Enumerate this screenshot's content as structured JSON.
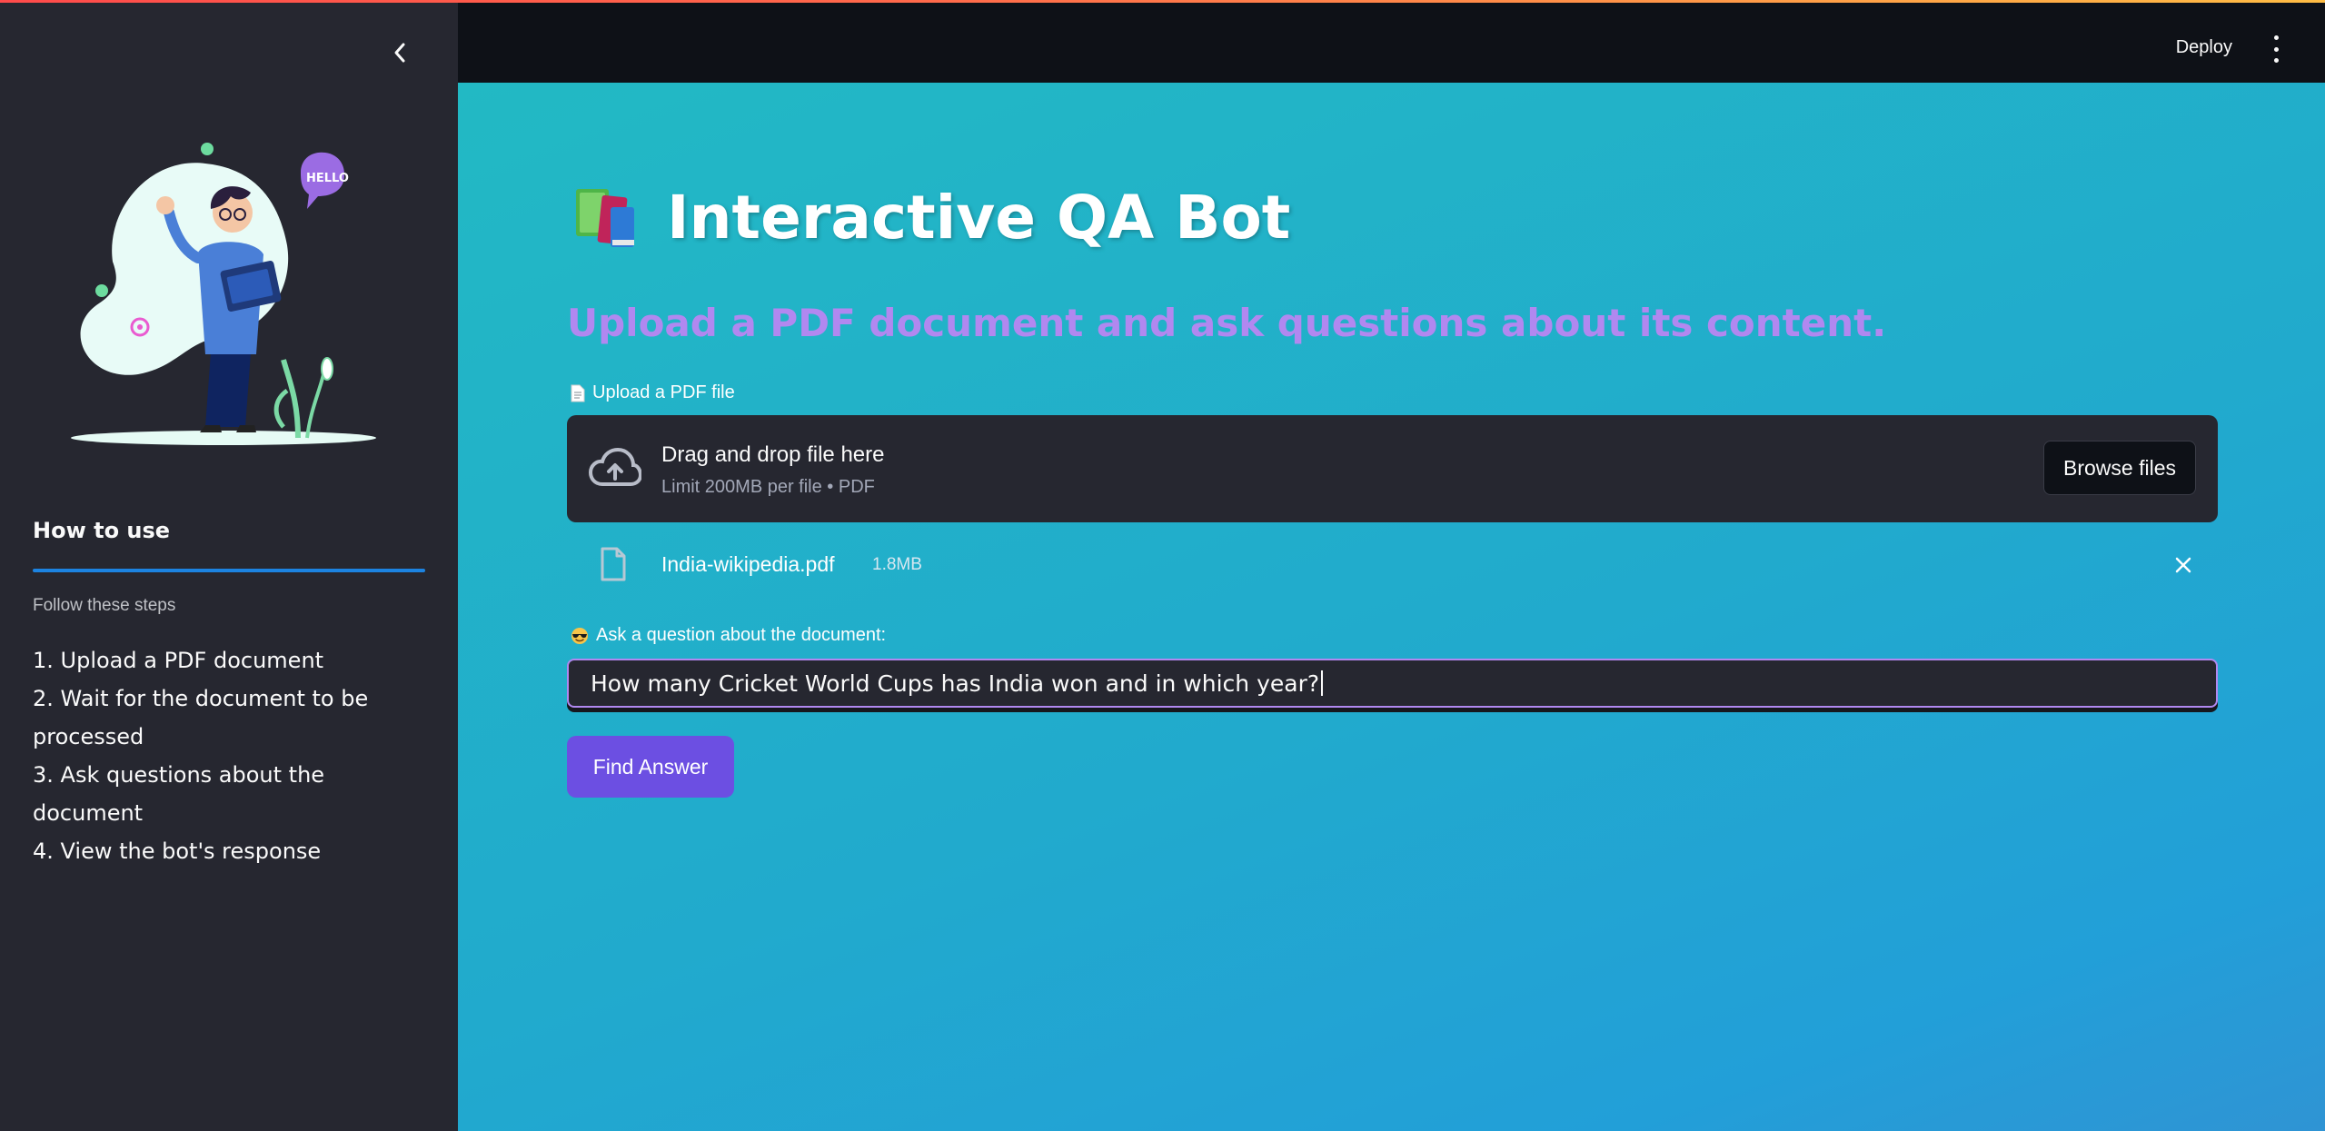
{
  "header": {
    "deploy_label": "Deploy"
  },
  "sidebar": {
    "illustration_text": "HELLO",
    "section_title": "How to use",
    "section_caption": "Follow these steps",
    "steps": [
      "1. Upload a PDF document",
      "2. Wait for the document to be processed",
      "3. Ask questions about the document",
      "4. View the bot's response"
    ]
  },
  "main": {
    "title": "Interactive QA Bot",
    "title_emoji": "books-icon",
    "subtitle": "Upload a PDF document and ask questions about its content.",
    "uploader": {
      "label": "Upload a PDF file",
      "label_icon": "page-icon",
      "drop_text": "Drag and drop file here",
      "limit_text": "Limit 200MB per file • PDF",
      "browse_label": "Browse files"
    },
    "uploaded_file": {
      "name": "India-wikipedia.pdf",
      "size": "1.8MB"
    },
    "question": {
      "label": "Ask a question about the document:",
      "label_icon": "sunglasses-emoji-icon",
      "value": "How many Cricket World Cups has India won and in which year?"
    },
    "find_label": "Find Answer"
  },
  "colors": {
    "sidebar_bg": "#262730",
    "header_bg": "#0e1117",
    "main_bg": "#22b9c4",
    "subtitle": "#b188f0",
    "button": "#6c4fe2",
    "accent_rule": "#1c83e1"
  }
}
